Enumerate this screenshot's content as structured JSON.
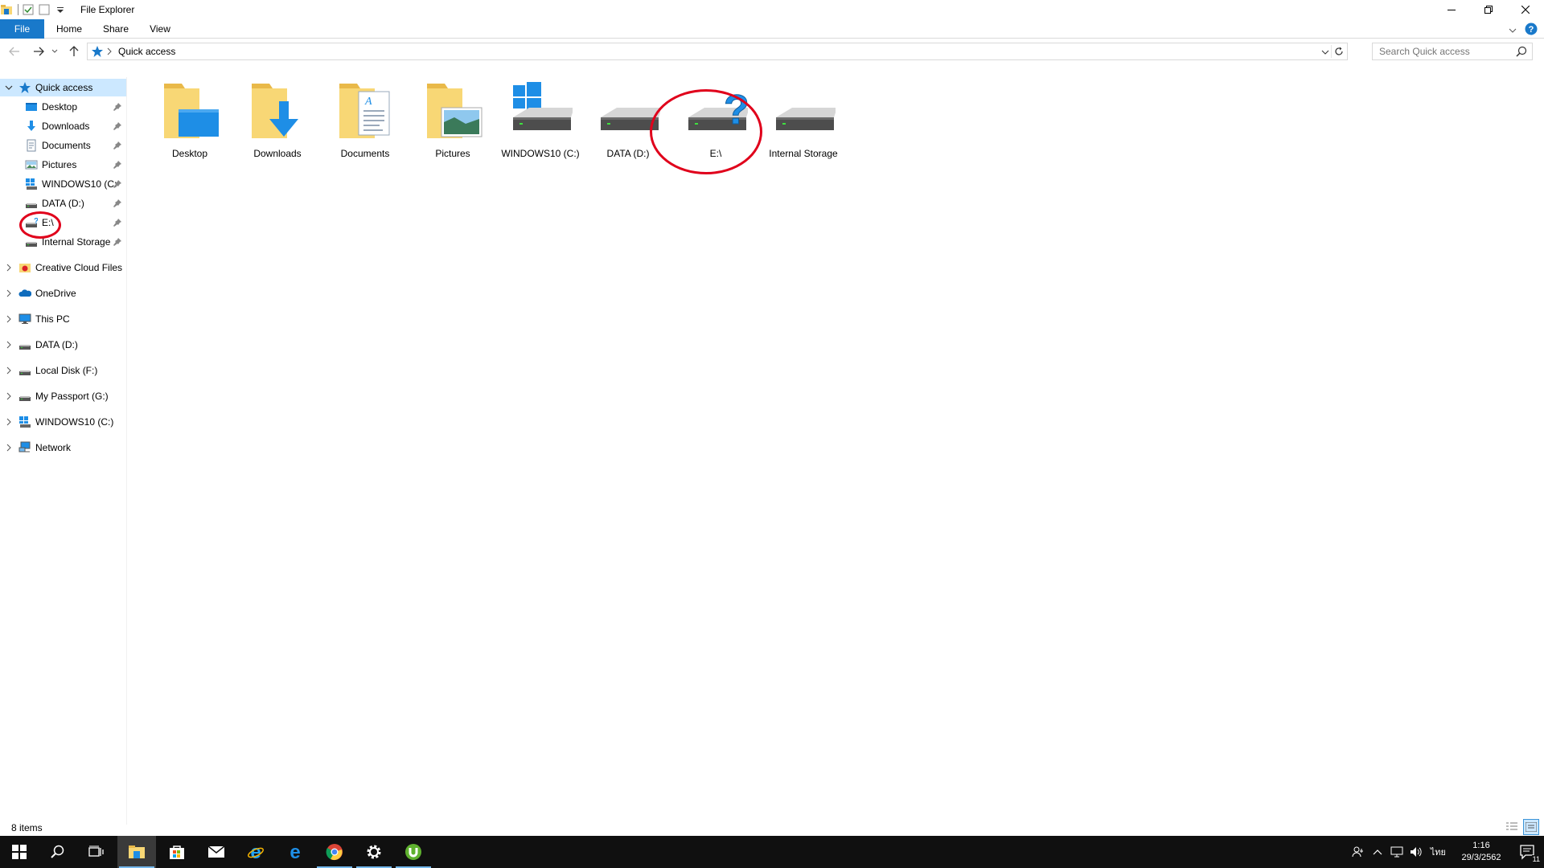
{
  "window": {
    "title": "File Explorer"
  },
  "ribbon": {
    "tabs": [
      {
        "label": "File"
      },
      {
        "label": "Home"
      },
      {
        "label": "Share"
      },
      {
        "label": "View"
      }
    ]
  },
  "address": {
    "location": "Quick access"
  },
  "search": {
    "placeholder": "Search Quick access"
  },
  "nav": {
    "quick_access": {
      "label": "Quick access"
    },
    "pinned": [
      {
        "label": "Desktop",
        "icon": "desktop-icon"
      },
      {
        "label": "Downloads",
        "icon": "downloads-icon"
      },
      {
        "label": "Documents",
        "icon": "documents-icon"
      },
      {
        "label": "Pictures",
        "icon": "pictures-icon"
      },
      {
        "label": "WINDOWS10 (C:",
        "icon": "windows-drive-icon"
      },
      {
        "label": "DATA (D:)",
        "icon": "drive-icon"
      },
      {
        "label": "E:\\",
        "icon": "unknown-drive-icon"
      },
      {
        "label": "Internal Storage",
        "icon": "drive-icon"
      }
    ],
    "roots": [
      {
        "label": "Creative Cloud Files",
        "icon": "creative-cloud-icon"
      },
      {
        "label": "OneDrive",
        "icon": "onedrive-icon"
      },
      {
        "label": "This PC",
        "icon": "this-pc-icon"
      },
      {
        "label": "DATA (D:)",
        "icon": "drive-icon"
      },
      {
        "label": "Local Disk (F:)",
        "icon": "drive-icon"
      },
      {
        "label": "My Passport (G:)",
        "icon": "drive-icon"
      },
      {
        "label": "WINDOWS10 (C:)",
        "icon": "windows-drive-icon"
      },
      {
        "label": "Network",
        "icon": "network-icon"
      }
    ]
  },
  "content": {
    "items": [
      {
        "label": "Desktop",
        "icon": "desktop-folder-icon"
      },
      {
        "label": "Downloads",
        "icon": "downloads-folder-icon"
      },
      {
        "label": "Documents",
        "icon": "documents-folder-icon"
      },
      {
        "label": "Pictures",
        "icon": "pictures-folder-icon"
      },
      {
        "label": "WINDOWS10 (C:)",
        "icon": "windows-drive-icon"
      },
      {
        "label": "DATA (D:)",
        "icon": "drive-icon"
      },
      {
        "label": "E:\\",
        "icon": "unknown-drive-icon"
      },
      {
        "label": "Internal Storage",
        "icon": "drive-icon"
      }
    ]
  },
  "status": {
    "item_count": "8 items"
  },
  "taskbar": {
    "apps": [
      {
        "icon": "start-icon"
      },
      {
        "icon": "search-icon"
      },
      {
        "icon": "task-view-icon"
      },
      {
        "icon": "file-explorer-icon"
      },
      {
        "icon": "store-icon"
      },
      {
        "icon": "mail-icon"
      },
      {
        "icon": "internet-explorer-icon"
      },
      {
        "icon": "edge-icon"
      },
      {
        "icon": "chrome-icon"
      },
      {
        "icon": "settings-icon"
      },
      {
        "icon": "utorrent-icon"
      }
    ],
    "tray": {
      "language": "ไทย",
      "time": "1:16",
      "date": "29/3/2562",
      "notification_count": "11"
    }
  },
  "colors": {
    "accent": "#1979ca",
    "selection": "#cce8ff",
    "folder": "#f8d775",
    "annotation": "#e0001b",
    "taskbar": "#101010"
  }
}
